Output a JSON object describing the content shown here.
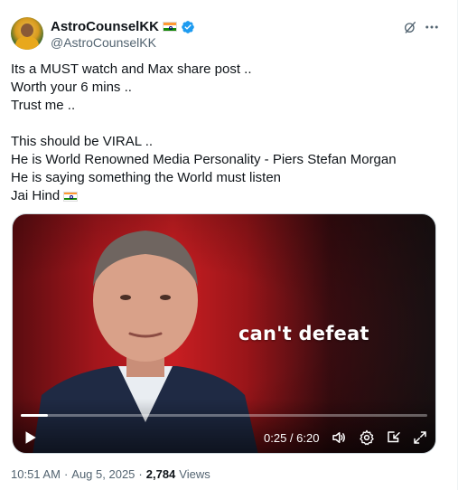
{
  "author": {
    "display_name": "AstroCounselKK",
    "handle": "@AstroCounselKK",
    "flag": "indian-flag-icon",
    "verified": "verified-badge-icon"
  },
  "header_actions": {
    "grok": "grok-icon",
    "more": "more-icon"
  },
  "tweet": {
    "lines": [
      "Its a MUST watch and Max share post ..",
      "Worth your 6 mins ..",
      "Trust me ..",
      "",
      "This should be VIRAL ..",
      "He is World Renowned Media Personality - Piers Stefan Morgan",
      "He is saying something the World must listen",
      "Jai Hind"
    ]
  },
  "video": {
    "caption": "can't defeat",
    "time_display": "0:25 / 6:20",
    "progress_fraction": 0.066,
    "controls": [
      "play-icon",
      "volume-icon",
      "settings-icon",
      "pip-icon",
      "fullscreen-icon"
    ]
  },
  "meta": {
    "time": "10:51 AM",
    "separator": "·",
    "date": "Aug 5, 2025",
    "views_count": "2,784",
    "views_label": "Views"
  },
  "colors": {
    "text": "#0f1419",
    "secondary": "#536471",
    "verified": "#1d9bf0"
  }
}
